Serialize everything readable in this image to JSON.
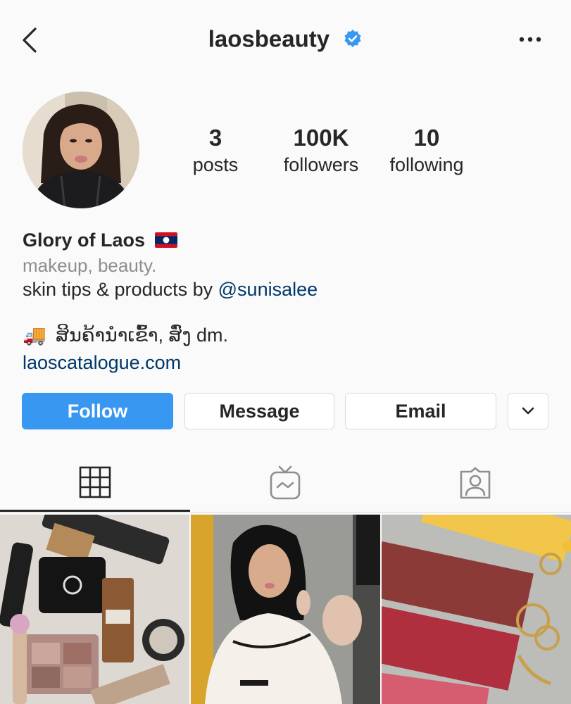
{
  "header": {
    "username": "laosbeauty",
    "verified_icon": "verified-badge-icon",
    "back_icon": "chevron-left-icon",
    "more_icon": "more-horizontal-icon"
  },
  "stats": [
    {
      "value": "3",
      "label": "posts"
    },
    {
      "value": "100K",
      "label": "followers"
    },
    {
      "value": "10",
      "label": "following"
    }
  ],
  "bio": {
    "name": "Glory of Laos",
    "flag_icon": "laos-flag-icon",
    "category": "makeup, beauty.",
    "line1_prefix": "skin tips & products by",
    "mention": "@sunisalee",
    "truck_emoji": "🚚",
    "line2": "ສິນຄ້ານໍາເຂົ້າ, ສົ່ງ dm.",
    "link": "laoscatalogue.com"
  },
  "buttons": {
    "follow": "Follow",
    "message": "Message",
    "email": "Email",
    "more_icon": "chevron-down-icon"
  },
  "tabs": [
    {
      "icon": "grid-icon",
      "active": true
    },
    {
      "icon": "igtv-icon",
      "active": false
    },
    {
      "icon": "tagged-icon",
      "active": false
    }
  ],
  "posts": [
    {
      "description": "makeup products collection"
    },
    {
      "description": "woman applying lip gloss"
    },
    {
      "description": "lip balm tubes with keychains"
    }
  ],
  "colors": {
    "accent": "#3897f0",
    "link": "#00376b",
    "muted": "#8e8e8e",
    "border": "#dbdbdb",
    "background": "#fafafa"
  }
}
